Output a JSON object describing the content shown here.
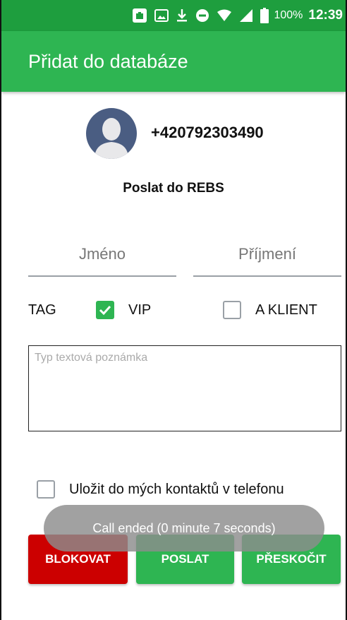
{
  "status_bar": {
    "battery": "100%",
    "time": "12:39"
  },
  "app_bar": {
    "title": "Přidat do databáze"
  },
  "contact": {
    "phone": "+420792303490",
    "send_label": "Poslat do REBS"
  },
  "fields": {
    "first_name_placeholder": "Jméno",
    "last_name_placeholder": "Příjmení"
  },
  "tags": {
    "label": "TAG",
    "vip": {
      "label": "VIP",
      "checked": true
    },
    "a_klient": {
      "label": "A KLIENT",
      "checked": false
    }
  },
  "note": {
    "placeholder": "Typ textová poznámka"
  },
  "save_contact": {
    "label": "Uložit do mých kontaktů v telefonu",
    "checked": false
  },
  "buttons": {
    "block": "BLOKOVAT",
    "send": "POSLAT",
    "skip": "PŘESKOČIT"
  },
  "toast": {
    "message": "Call ended (0 minute 7 seconds)"
  },
  "colors": {
    "status_bar": "#1e9e3e",
    "app_bar": "#2eb552",
    "block_button": "#cc0000",
    "accent": "#2eb552"
  },
  "icons": {
    "status": [
      "briefcase-icon",
      "image-icon",
      "download-icon",
      "do-not-disturb-icon",
      "wifi-icon",
      "signal-icon",
      "battery-icon"
    ]
  }
}
